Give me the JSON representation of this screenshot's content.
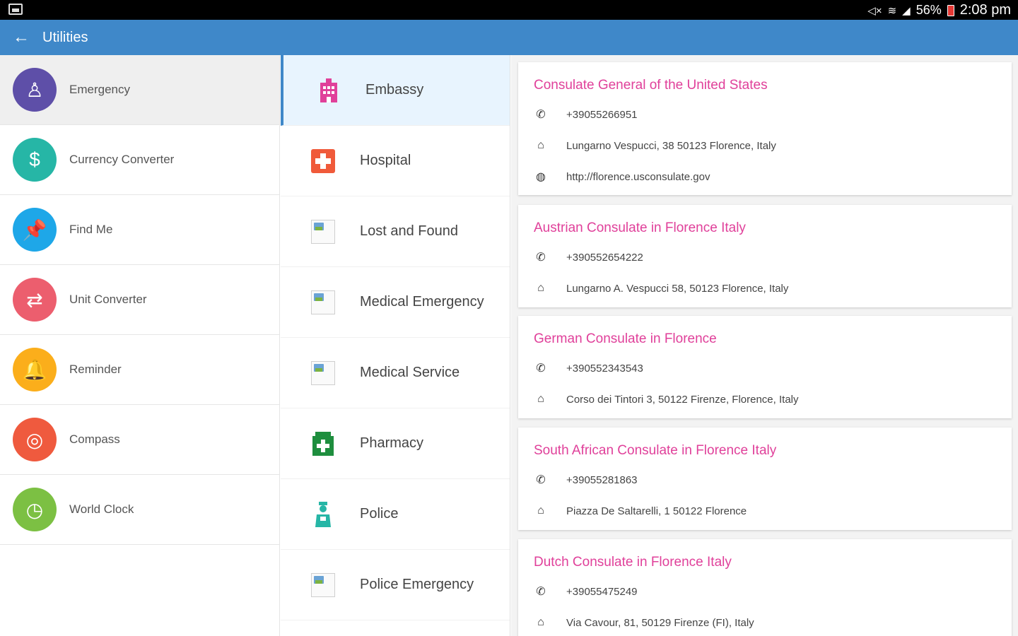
{
  "status_bar": {
    "battery": "56%",
    "time": "2:08 pm"
  },
  "app_bar": {
    "title": "Utilities"
  },
  "left_menu": [
    {
      "label": "Emergency",
      "icon": "lifebuoy-person-icon",
      "color": "#5e4fa8",
      "glyph": "♙",
      "active": true
    },
    {
      "label": "Currency Converter",
      "icon": "currency-exchange-icon",
      "color": "#26b6a6",
      "glyph": "$",
      "active": false
    },
    {
      "label": "Find Me",
      "icon": "pin-icon",
      "color": "#1ea7e8",
      "glyph": "📌",
      "active": false
    },
    {
      "label": "Unit Converter",
      "icon": "swap-arrows-icon",
      "color": "#ec5e6e",
      "glyph": "⇄",
      "active": false
    },
    {
      "label": "Reminder",
      "icon": "bell-icon",
      "color": "#fbae1b",
      "glyph": "🔔",
      "active": false
    },
    {
      "label": "Compass",
      "icon": "compass-icon",
      "color": "#ef5a3e",
      "glyph": "◎",
      "active": false
    },
    {
      "label": "World Clock",
      "icon": "clock-icon",
      "color": "#7cc043",
      "glyph": "◷",
      "active": false
    }
  ],
  "categories": [
    {
      "label": "Embassy",
      "icon": "building-icon",
      "active": true
    },
    {
      "label": "Hospital",
      "icon": "hospital-cross-icon",
      "active": false
    },
    {
      "label": "Lost and Found",
      "icon": "broken-image-icon",
      "active": false
    },
    {
      "label": "Medical Emergency",
      "icon": "broken-image-icon",
      "active": false
    },
    {
      "label": "Medical Service",
      "icon": "broken-image-icon",
      "active": false
    },
    {
      "label": "Pharmacy",
      "icon": "pharmacy-icon",
      "active": false
    },
    {
      "label": "Police",
      "icon": "police-officer-icon",
      "active": false
    },
    {
      "label": "Police Emergency",
      "icon": "broken-image-icon",
      "active": false
    }
  ],
  "consulates": [
    {
      "name": "Consulate General of the United States",
      "phone": "+39055266951",
      "address": "Lungarno Vespucci, 38 50123 Florence, Italy",
      "website": "http://florence.usconsulate.gov"
    },
    {
      "name": "Austrian Consulate in Florence Italy",
      "phone": "+390552654222",
      "address": "Lungarno A. Vespucci 58, 50123 Florence, Italy"
    },
    {
      "name": "German Consulate in Florence",
      "phone": "+390552343543",
      "address": "Corso dei Tintori 3, 50122 Firenze, Florence, Italy"
    },
    {
      "name": "South African Consulate in Florence Italy",
      "phone": "+39055281863",
      "address": "Piazza De Saltarelli, 1 50122 Florence"
    },
    {
      "name": "Dutch Consulate in Florence Italy",
      "phone": "+39055475249",
      "address": "Via Cavour, 81, 50129 Firenze (FI), Italy"
    }
  ]
}
